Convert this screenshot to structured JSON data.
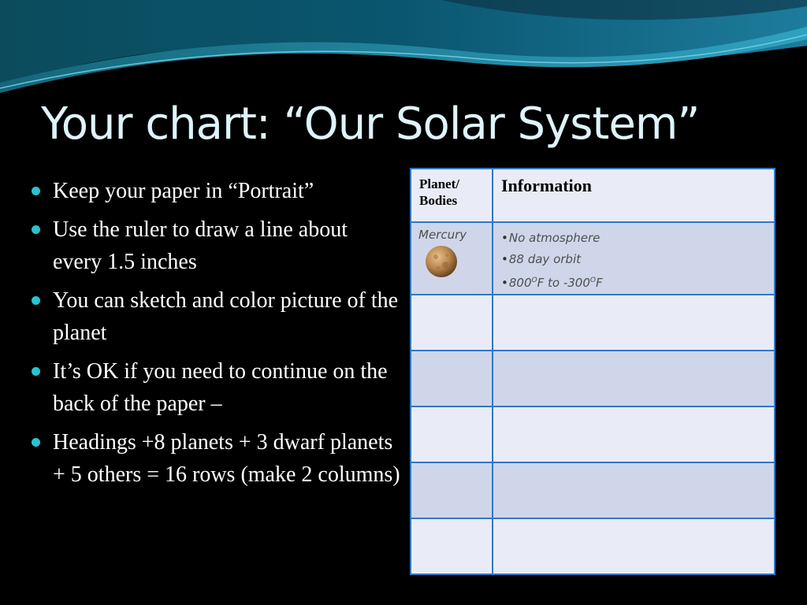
{
  "slide": {
    "title": "Your chart: “Our Solar System”",
    "bullets": [
      "Keep your paper in “Portrait”",
      "Use the ruler to draw a line about every 1.5 inches",
      "You can sketch and color picture of the planet",
      "It’s OK if you need to continue on the back of the paper –",
      "Headings +8 planets + 3 dwarf planets + 5 others = 16 rows (make 2 columns)"
    ],
    "accent_color": "#27c4cf",
    "title_color": "#dff4fa"
  },
  "table": {
    "headers": [
      "Planet/ Bodies",
      "Information"
    ],
    "first_row": {
      "planet": "Mercury",
      "planet_image": "mercury-planet-sketch",
      "info": {
        "line1": "No atmosphere",
        "line2": "88 day orbit",
        "line3_hot": "800",
        "line3_mid": "F to -300",
        "line3_end": "F",
        "degree_mark": "O"
      }
    },
    "blank_rows": 5,
    "border_color": "#3277c8",
    "row_colors": [
      "#cfd6ea",
      "#e9ecf6"
    ]
  }
}
